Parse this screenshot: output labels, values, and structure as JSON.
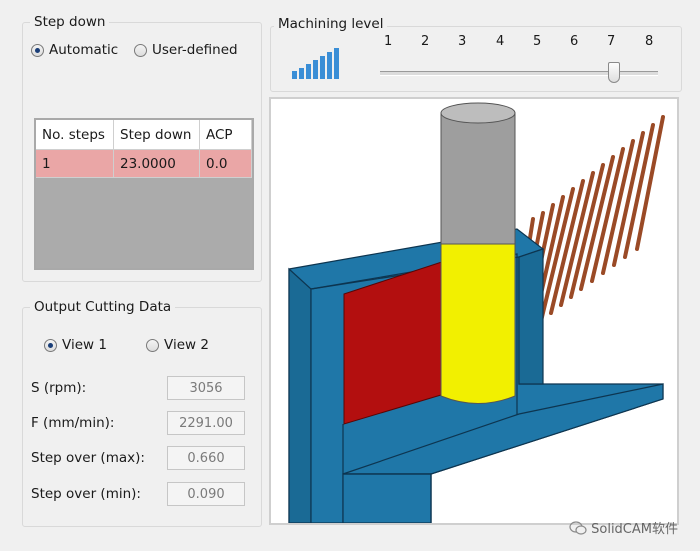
{
  "step_down": {
    "title": "Step down",
    "automatic_label": "Automatic",
    "user_defined_label": "User-defined",
    "selected": "automatic",
    "table": {
      "columns": [
        "No. steps",
        "Step down",
        "ACP"
      ],
      "rows": [
        [
          "1",
          "23.0000",
          "0.0"
        ]
      ]
    }
  },
  "machining": {
    "title": "Machining level",
    "ticks": [
      "1",
      "2",
      "3",
      "4",
      "5",
      "6",
      "7",
      "8"
    ],
    "level": 7
  },
  "output": {
    "title": "Output Cutting Data",
    "view1_label": "View 1",
    "view2_label": "View 2",
    "selected": "view1",
    "s_label": "S (rpm):",
    "s_value": "3056",
    "f_label": "F (mm/min):",
    "f_value": "2291.00",
    "so_max_label": "Step over (max):",
    "so_max_value": "0.660",
    "so_min_label": "Step over (min):",
    "so_min_value": "0.090"
  },
  "watermark": "SolidCAM软件",
  "colors": {
    "row_highlight": "#eaa6a6",
    "part": "#1f77a8",
    "wall": "#b30f0f",
    "tool_holder": "#9e9e9e",
    "tool_body": "#f2f000",
    "toolpath": "#9a4a26"
  }
}
